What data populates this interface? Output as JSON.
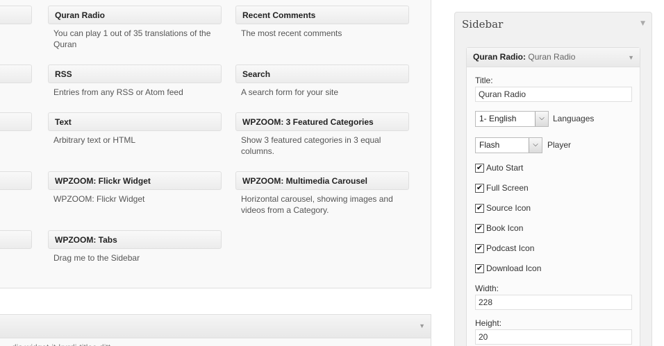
{
  "available_widgets": [
    {
      "title": "Quran Radio",
      "desc": "You can play 1 out of 35 translations of the Quran"
    },
    {
      "title": "Recent Comments",
      "desc": "The most recent comments"
    },
    {
      "title": "RSS",
      "desc": "Entries from any RSS or Atom feed"
    },
    {
      "title": "Search",
      "desc": "A search form for your site"
    },
    {
      "title": "Text",
      "desc": "Arbitrary text or HTML"
    },
    {
      "title": "WPZOOM: 3 Featured Categories",
      "desc": "Show 3 featured categories in 3 equal columns."
    },
    {
      "title": "WPZOOM: Flickr Widget",
      "desc": "WPZOOM: Flickr Widget"
    },
    {
      "title": "WPZOOM: Multimedia Carousel",
      "desc": "Horizontal carousel, showing images and videos from a Category."
    },
    {
      "title": "WPZOOM: Tabs",
      "desc": "Drag me to the Sidebar"
    }
  ],
  "lower_panel": {
    "text": "...dis widget-it-kurdi-titlec-ditt..."
  },
  "sidebar": {
    "title": "Sidebar",
    "widget": {
      "name": "Quran Radio:",
      "in_title": "Quran Radio",
      "title_label": "Title:",
      "title_value": "Quran Radio",
      "language_value": "1- English",
      "language_caption": "Languages",
      "player_value": "Flash",
      "player_caption": "Player",
      "checkboxes": [
        {
          "label": "Auto Start",
          "checked": true
        },
        {
          "label": "Full Screen",
          "checked": true
        },
        {
          "label": "Source Icon",
          "checked": true
        },
        {
          "label": "Book Icon",
          "checked": true
        },
        {
          "label": "Podcast Icon",
          "checked": true
        },
        {
          "label": "Download Icon",
          "checked": true
        }
      ],
      "width_label": "Width:",
      "width_value": "228",
      "height_label": "Height:",
      "height_value": "20"
    }
  },
  "icons": {
    "collapse": "triangle-down-icon",
    "select_arrow": "chevron-down-icon",
    "check": "check-icon"
  }
}
